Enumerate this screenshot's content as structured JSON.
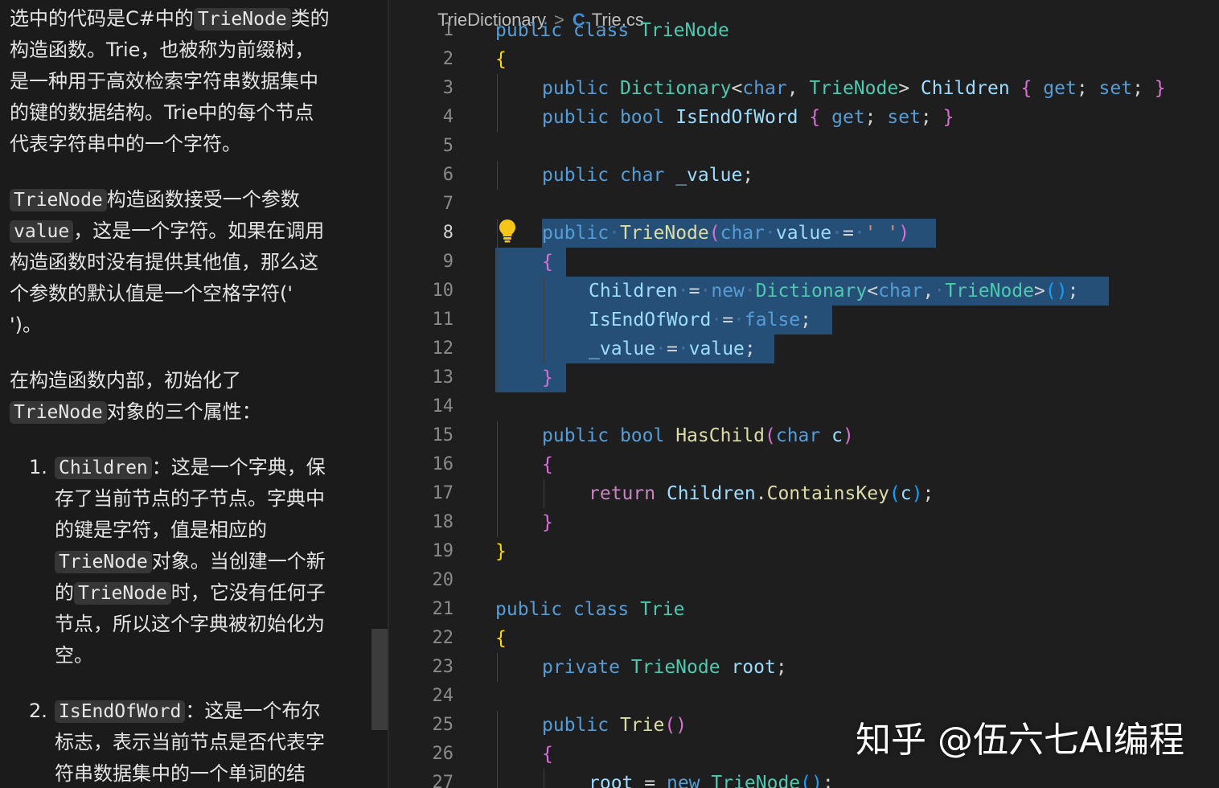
{
  "chat": {
    "paragraphs": [
      {
        "lines": [
          [
            {
              "t": "选中的代码是C#中的"
            },
            {
              "c": "TrieNode"
            },
            {
              "t": "类的"
            }
          ],
          [
            {
              "t": "构造函数。Trie，也被称为前缀树，"
            }
          ],
          [
            {
              "t": "是一种用于高效检索字符串数据集中"
            }
          ],
          [
            {
              "t": "的键的数据结构。Trie中的每个节点"
            }
          ],
          [
            {
              "t": "代表字符串中的一个字符。"
            }
          ]
        ]
      },
      {
        "lines": [
          [
            {
              "c": "TrieNode"
            },
            {
              "t": "构造函数接受一个参数"
            }
          ],
          [
            {
              "c": "value"
            },
            {
              "t": "，这是一个字符。如果在调用"
            }
          ],
          [
            {
              "t": "构造函数时没有提供其他值，那么这"
            }
          ],
          [
            {
              "t": "个参数的默认值是一个空格字符('"
            }
          ],
          [
            {
              "t": "')。"
            }
          ]
        ]
      },
      {
        "lines": [
          [
            {
              "t": "在构造函数内部，初始化了"
            }
          ],
          [
            {
              "c": "TrieNode"
            },
            {
              "t": "对象的三个属性："
            }
          ]
        ]
      }
    ],
    "list": [
      {
        "num": "1.",
        "lines": [
          [
            {
              "c": "Children"
            },
            {
              "t": "：这是一个字典，保"
            }
          ],
          [
            {
              "t": "存了当前节点的子节点。字典中"
            }
          ],
          [
            {
              "t": "的键是字符，值是相应的"
            }
          ],
          [
            {
              "c": "TrieNode"
            },
            {
              "t": "对象。当创建一个新"
            }
          ],
          [
            {
              "t": "的"
            },
            {
              "c": "TrieNode"
            },
            {
              "t": "时，它没有任何子"
            }
          ],
          [
            {
              "t": "节点，所以这个字典被初始化为"
            }
          ],
          [
            {
              "t": "空。"
            }
          ]
        ]
      },
      {
        "num": "2.",
        "lines": [
          [
            {
              "c": "IsEndOfWord"
            },
            {
              "t": "：这是一个布尔"
            }
          ],
          [
            {
              "t": "标志，表示当前节点是否代表字"
            }
          ],
          [
            {
              "t": "符串数据集中的一个单词的结"
            }
          ]
        ]
      }
    ]
  },
  "editor": {
    "breadcrumb": [
      "TrieDictionary",
      "Trie.cs"
    ],
    "breadcrumb_sep": ">",
    "active_line": 8,
    "lines": [
      {
        "n": 1,
        "i": 0,
        "tk": [
          [
            "kw",
            "public"
          ],
          [
            "",
            "␣"
          ],
          [
            "kw",
            "class"
          ],
          [
            "",
            "␣"
          ],
          [
            "ty",
            "TrieNode"
          ]
        ]
      },
      {
        "n": 2,
        "i": 0,
        "tk": [
          [
            "b1",
            "{"
          ]
        ]
      },
      {
        "n": 3,
        "i": 1,
        "tk": [
          [
            "kw",
            "public"
          ],
          [
            "",
            "␣"
          ],
          [
            "ty",
            "Dictionary"
          ],
          [
            "pn",
            "<"
          ],
          [
            "kw",
            "char"
          ],
          [
            "pn",
            ","
          ],
          [
            "",
            "␣"
          ],
          [
            "ty",
            "TrieNode"
          ],
          [
            "pn",
            ">"
          ],
          [
            "",
            "␣"
          ],
          [
            "id",
            "Children"
          ],
          [
            "",
            "␣"
          ],
          [
            "b2",
            "{"
          ],
          [
            "",
            "␣"
          ],
          [
            "kw",
            "get"
          ],
          [
            "pn",
            ";"
          ],
          [
            "",
            "␣"
          ],
          [
            "kw",
            "set"
          ],
          [
            "pn",
            ";"
          ],
          [
            "",
            "␣"
          ],
          [
            "b2",
            "}"
          ]
        ]
      },
      {
        "n": 4,
        "i": 1,
        "tk": [
          [
            "kw",
            "public"
          ],
          [
            "",
            "␣"
          ],
          [
            "kw",
            "bool"
          ],
          [
            "",
            "␣"
          ],
          [
            "id",
            "IsEndOfWord"
          ],
          [
            "",
            "␣"
          ],
          [
            "b2",
            "{"
          ],
          [
            "",
            "␣"
          ],
          [
            "kw",
            "get"
          ],
          [
            "pn",
            ";"
          ],
          [
            "",
            "␣"
          ],
          [
            "kw",
            "set"
          ],
          [
            "pn",
            ";"
          ],
          [
            "",
            "␣"
          ],
          [
            "b2",
            "}"
          ]
        ]
      },
      {
        "n": 5,
        "i": 0,
        "tk": []
      },
      {
        "n": 6,
        "i": 1,
        "tk": [
          [
            "kw",
            "public"
          ],
          [
            "",
            "␣"
          ],
          [
            "kw",
            "char"
          ],
          [
            "",
            "␣"
          ],
          [
            "id",
            "_value"
          ],
          [
            "pn",
            ";"
          ]
        ]
      },
      {
        "n": 7,
        "i": 0,
        "tk": []
      },
      {
        "n": 8,
        "i": 1,
        "tk": [
          [
            "kw",
            "public"
          ],
          [
            "",
            "␣"
          ],
          [
            "fn",
            "TrieNode"
          ],
          [
            "b2",
            "("
          ],
          [
            "kw",
            "char"
          ],
          [
            "",
            "␣"
          ],
          [
            "id",
            "value"
          ],
          [
            "",
            "␣"
          ],
          [
            "pn",
            "="
          ],
          [
            "",
            "␣"
          ],
          [
            "st",
            "' '"
          ],
          [
            "b2",
            ")"
          ]
        ]
      },
      {
        "n": 9,
        "i": 1,
        "tk": [
          [
            "b2",
            "{"
          ]
        ]
      },
      {
        "n": 10,
        "i": 2,
        "tk": [
          [
            "id",
            "Children"
          ],
          [
            "",
            "␣"
          ],
          [
            "pn",
            "="
          ],
          [
            "",
            "␣"
          ],
          [
            "kw",
            "new"
          ],
          [
            "",
            "␣"
          ],
          [
            "ty",
            "Dictionary"
          ],
          [
            "pn",
            "<"
          ],
          [
            "kw",
            "char"
          ],
          [
            "pn",
            ","
          ],
          [
            "",
            "␣"
          ],
          [
            "ty",
            "TrieNode"
          ],
          [
            "pn",
            ">"
          ],
          [
            "b3",
            "()"
          ],
          [
            "pn",
            ";"
          ]
        ]
      },
      {
        "n": 11,
        "i": 2,
        "tk": [
          [
            "id",
            "IsEndOfWord"
          ],
          [
            "",
            "␣"
          ],
          [
            "pn",
            "="
          ],
          [
            "",
            "␣"
          ],
          [
            "kw",
            "false"
          ],
          [
            "pn",
            ";"
          ]
        ]
      },
      {
        "n": 12,
        "i": 2,
        "tk": [
          [
            "id",
            "_value"
          ],
          [
            "",
            "␣"
          ],
          [
            "pn",
            "="
          ],
          [
            "",
            "␣"
          ],
          [
            "id",
            "value"
          ],
          [
            "pn",
            ";"
          ]
        ]
      },
      {
        "n": 13,
        "i": 1,
        "tk": [
          [
            "b2",
            "}"
          ]
        ]
      },
      {
        "n": 14,
        "i": 0,
        "tk": []
      },
      {
        "n": 15,
        "i": 1,
        "tk": [
          [
            "kw",
            "public"
          ],
          [
            "",
            "␣"
          ],
          [
            "kw",
            "bool"
          ],
          [
            "",
            "␣"
          ],
          [
            "fn",
            "HasChild"
          ],
          [
            "b2",
            "("
          ],
          [
            "kw",
            "char"
          ],
          [
            "",
            "␣"
          ],
          [
            "id",
            "c"
          ],
          [
            "b2",
            ")"
          ]
        ]
      },
      {
        "n": 16,
        "i": 1,
        "tk": [
          [
            "b2",
            "{"
          ]
        ]
      },
      {
        "n": 17,
        "i": 2,
        "tk": [
          [
            "ct",
            "return"
          ],
          [
            "",
            "␣"
          ],
          [
            "id",
            "Children"
          ],
          [
            "pn",
            "."
          ],
          [
            "fn",
            "ContainsKey"
          ],
          [
            "b3",
            "("
          ],
          [
            "id",
            "c"
          ],
          [
            "b3",
            ")"
          ],
          [
            "pn",
            ";"
          ]
        ]
      },
      {
        "n": 18,
        "i": 1,
        "tk": [
          [
            "b2",
            "}"
          ]
        ]
      },
      {
        "n": 19,
        "i": 0,
        "tk": [
          [
            "b1",
            "}"
          ]
        ]
      },
      {
        "n": 20,
        "i": 0,
        "tk": []
      },
      {
        "n": 21,
        "i": 0,
        "tk": [
          [
            "kw",
            "public"
          ],
          [
            "",
            "␣"
          ],
          [
            "kw",
            "class"
          ],
          [
            "",
            "␣"
          ],
          [
            "ty",
            "Trie"
          ]
        ]
      },
      {
        "n": 22,
        "i": 0,
        "tk": [
          [
            "b1",
            "{"
          ]
        ]
      },
      {
        "n": 23,
        "i": 1,
        "tk": [
          [
            "kw",
            "private"
          ],
          [
            "",
            "␣"
          ],
          [
            "ty",
            "TrieNode"
          ],
          [
            "",
            "␣"
          ],
          [
            "id",
            "root"
          ],
          [
            "pn",
            ";"
          ]
        ]
      },
      {
        "n": 24,
        "i": 0,
        "tk": []
      },
      {
        "n": 25,
        "i": 1,
        "tk": [
          [
            "kw",
            "public"
          ],
          [
            "",
            "␣"
          ],
          [
            "fn",
            "Trie"
          ],
          [
            "b2",
            "()"
          ]
        ]
      },
      {
        "n": 26,
        "i": 1,
        "tk": [
          [
            "b2",
            "{"
          ]
        ]
      },
      {
        "n": 27,
        "i": 2,
        "tk": [
          [
            "id",
            "root"
          ],
          [
            "",
            "␣"
          ],
          [
            "pn",
            "="
          ],
          [
            "",
            "␣"
          ],
          [
            "kw",
            "new"
          ],
          [
            "",
            "␣"
          ],
          [
            "ty",
            "TrieNode"
          ],
          [
            "b3",
            "()"
          ],
          [
            "pn",
            ";"
          ]
        ]
      }
    ]
  },
  "watermark": "知乎 @伍六七AI编程",
  "icons": {
    "lightbulb": "lightbulb-icon",
    "file": "csharp-file-icon"
  },
  "colors": {
    "selection": "#264f78",
    "keyword": "#569cd6",
    "type": "#4ec9b0",
    "identifier": "#9cdcfe",
    "function": "#dcdcaa",
    "string": "#ce9178",
    "control": "#c586c0",
    "bulb": "#f5c518"
  }
}
